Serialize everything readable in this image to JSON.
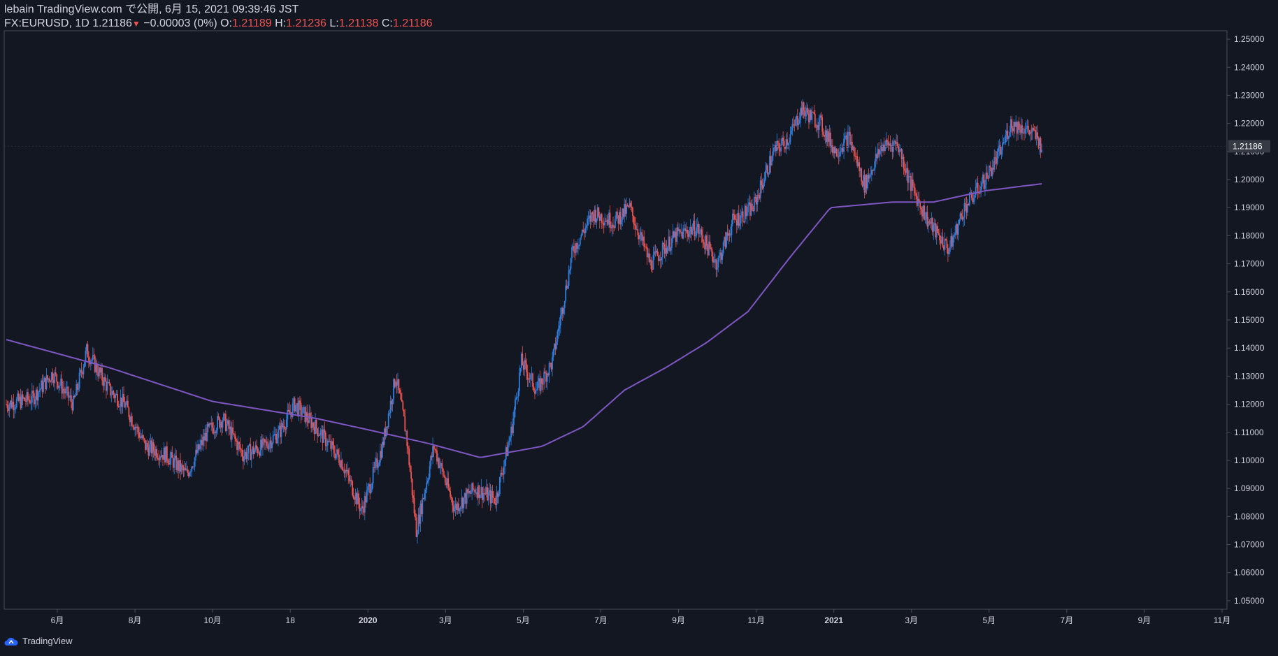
{
  "header": {
    "published_line": "lebain TradingView.com で公開, 6月 15, 2021 09:39:46 JST",
    "symbol": "FX:EURUSD, 1D",
    "last": "1.21186",
    "down_arrow": "▼",
    "change": "−0.00003 (0%)",
    "o_label": "O:",
    "o_value": "1.21189",
    "h_label": "H:",
    "h_value": "1.21236",
    "l_label": "L:",
    "l_value": "1.21138",
    "c_label": "C:",
    "c_value": "1.21186"
  },
  "footer": {
    "brand": "TradingView"
  },
  "colors": {
    "background": "#131722",
    "up": "#2e7fe0",
    "down": "#ef5350",
    "ma": "#7e57c2",
    "text": "#d1d4dc",
    "axis": "#4a4e5a"
  },
  "chart_data": {
    "type": "candlestick",
    "symbol": "FX:EURUSD",
    "interval": "1D",
    "x_ticks": [
      "6月",
      "8月",
      "10月",
      "18",
      "2020",
      "3月",
      "5月",
      "7月",
      "9月",
      "11月",
      "2021",
      "3月",
      "5月",
      "7月",
      "9月",
      "11月"
    ],
    "y_ticks": [
      "1.25000",
      "1.24000",
      "1.23000",
      "1.22000",
      "1.21000",
      "1.20000",
      "1.19000",
      "1.18000",
      "1.17000",
      "1.16000",
      "1.15000",
      "1.14000",
      "1.13000",
      "1.12000",
      "1.11000",
      "1.10000",
      "1.09000",
      "1.08000",
      "1.07000",
      "1.06000",
      "1.05000"
    ],
    "ylim": [
      1.047,
      1.253
    ],
    "last_price_label": "1.21186",
    "close_anchors": [
      [
        0,
        1.12
      ],
      [
        25,
        1.122
      ],
      [
        45,
        1.131
      ],
      [
        65,
        1.12
      ],
      [
        78,
        1.139
      ],
      [
        100,
        1.125
      ],
      [
        115,
        1.12
      ],
      [
        135,
        1.105
      ],
      [
        155,
        1.102
      ],
      [
        175,
        1.095
      ],
      [
        195,
        1.11
      ],
      [
        210,
        1.115
      ],
      [
        230,
        1.102
      ],
      [
        250,
        1.105
      ],
      [
        265,
        1.11
      ],
      [
        280,
        1.12
      ],
      [
        300,
        1.112
      ],
      [
        325,
        1.1
      ],
      [
        345,
        1.082
      ],
      [
        365,
        1.105
      ],
      [
        378,
        1.13
      ],
      [
        388,
        1.11
      ],
      [
        398,
        1.075
      ],
      [
        415,
        1.105
      ],
      [
        435,
        1.083
      ],
      [
        455,
        1.09
      ],
      [
        475,
        1.086
      ],
      [
        490,
        1.11
      ],
      [
        500,
        1.135
      ],
      [
        515,
        1.125
      ],
      [
        530,
        1.135
      ],
      [
        550,
        1.175
      ],
      [
        570,
        1.188
      ],
      [
        590,
        1.185
      ],
      [
        605,
        1.19
      ],
      [
        625,
        1.17
      ],
      [
        650,
        1.18
      ],
      [
        670,
        1.183
      ],
      [
        690,
        1.17
      ],
      [
        705,
        1.185
      ],
      [
        725,
        1.19
      ],
      [
        745,
        1.21
      ],
      [
        760,
        1.215
      ],
      [
        772,
        1.225
      ],
      [
        790,
        1.22
      ],
      [
        805,
        1.21
      ],
      [
        818,
        1.215
      ],
      [
        833,
        1.198
      ],
      [
        850,
        1.212
      ],
      [
        865,
        1.213
      ],
      [
        878,
        1.198
      ],
      [
        895,
        1.185
      ],
      [
        915,
        1.175
      ],
      [
        930,
        1.19
      ],
      [
        950,
        1.2
      ],
      [
        965,
        1.21
      ],
      [
        975,
        1.22
      ],
      [
        990,
        1.218
      ],
      [
        1000,
        1.215
      ],
      [
        1005,
        1.2118
      ]
    ],
    "ma_anchors": [
      [
        0,
        1.143
      ],
      [
        100,
        1.133
      ],
      [
        200,
        1.121
      ],
      [
        300,
        1.115
      ],
      [
        350,
        1.111
      ],
      [
        410,
        1.106
      ],
      [
        460,
        1.101
      ],
      [
        520,
        1.105
      ],
      [
        560,
        1.112
      ],
      [
        600,
        1.125
      ],
      [
        640,
        1.133
      ],
      [
        680,
        1.142
      ],
      [
        720,
        1.153
      ],
      [
        760,
        1.172
      ],
      [
        800,
        1.19
      ],
      [
        860,
        1.192
      ],
      [
        900,
        1.192
      ],
      [
        950,
        1.196
      ],
      [
        1005,
        1.1985
      ]
    ]
  }
}
